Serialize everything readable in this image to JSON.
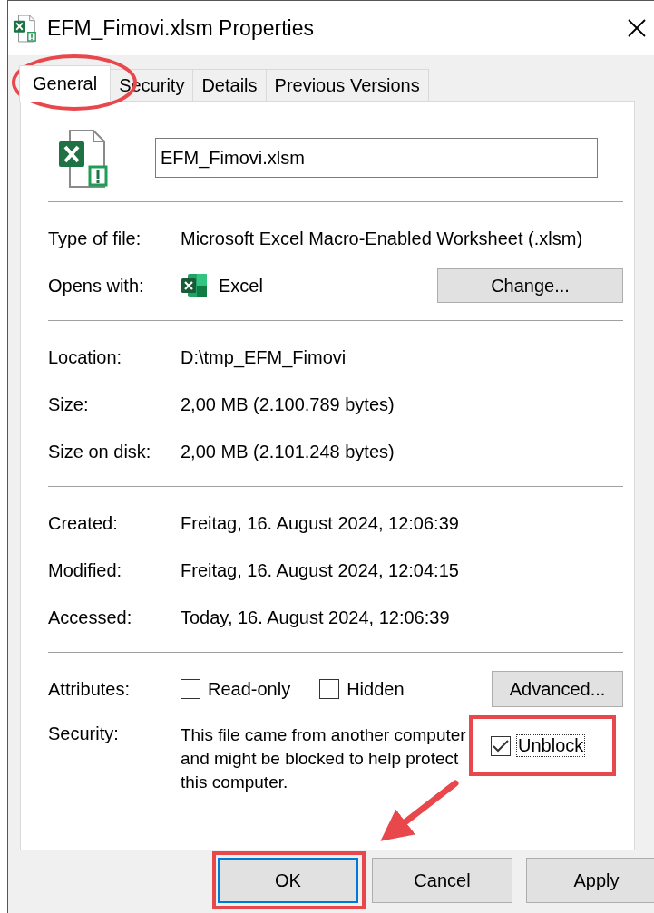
{
  "window": {
    "title": "EFM_Fimovi.xlsm Properties"
  },
  "tabs": [
    {
      "label": "General",
      "selected": true
    },
    {
      "label": "Security",
      "selected": false
    },
    {
      "label": "Details",
      "selected": false
    },
    {
      "label": "Previous Versions",
      "selected": false
    }
  ],
  "file_name_field": {
    "value": "EFM_Fimovi.xlsm"
  },
  "groups": [
    [
      {
        "kind": "text",
        "label": "Type of file:",
        "value": "Microsoft Excel Macro-Enabled Worksheet (.xlsm)"
      },
      {
        "kind": "app",
        "label": "Opens with:",
        "value": "Excel",
        "button": "Change..."
      }
    ],
    [
      {
        "kind": "text",
        "label": "Location:",
        "value": "D:\\tmp_EFM_Fimovi"
      },
      {
        "kind": "text",
        "label": "Size:",
        "value": "2,00 MB (2.100.789 bytes)"
      },
      {
        "kind": "text",
        "label": "Size on disk:",
        "value": "2,00 MB (2.101.248 bytes)"
      }
    ],
    [
      {
        "kind": "text",
        "label": "Created:",
        "value": "Freitag, 16. August 2024, 12:06:39"
      },
      {
        "kind": "text",
        "label": "Modified:",
        "value": "Freitag, 16. August 2024, 12:04:15"
      },
      {
        "kind": "text",
        "label": "Accessed:",
        "value": "Today, 16. August 2024, 12:06:39"
      }
    ],
    [
      {
        "kind": "checks",
        "label": "Attributes:",
        "checkboxes": [
          {
            "label": "Read-only",
            "checked": false
          },
          {
            "label": "Hidden",
            "checked": false
          }
        ],
        "button": "Advanced..."
      },
      {
        "kind": "security",
        "label": "Security:",
        "value": "This file came from another computer and might be blocked to help protect this computer.",
        "checkbox": {
          "label": "Unblock",
          "checked": true,
          "focused": true
        }
      }
    ]
  ],
  "buttons": [
    {
      "label": "OK",
      "default": true
    },
    {
      "label": "Cancel",
      "default": false
    },
    {
      "label": "Apply",
      "default": false
    }
  ]
}
